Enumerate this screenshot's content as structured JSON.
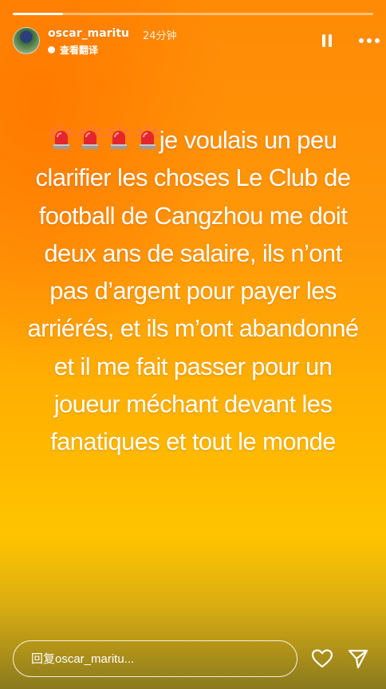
{
  "story": {
    "progress_fraction": 0.14,
    "colors": {
      "gradient_top": "#ff8a05",
      "gradient_mid": "#ffb300",
      "gradient_bottom": "#8a7a1e"
    }
  },
  "header": {
    "username": "oscar_maritu",
    "time_ago": "24分钟",
    "translate_label": "查看翻译",
    "icons": [
      "avatar",
      "pause-icon",
      "more-icon"
    ]
  },
  "content": {
    "emoji_name": "police-car-light",
    "emoji_count": 4,
    "text": "je voulais un peu clarifier les choses Le Club de football de Cangzhou  me doit deux ans de salaire, ils n’ont pas d’argent pour payer les arriérés, et ils m’ont abandonné et il me fait passer pour un joueur méchant devant les fanatiques et tout le monde"
  },
  "footer": {
    "reply_placeholder": "回复oscar_maritu...",
    "icons": [
      "heart-icon",
      "send-icon"
    ]
  }
}
